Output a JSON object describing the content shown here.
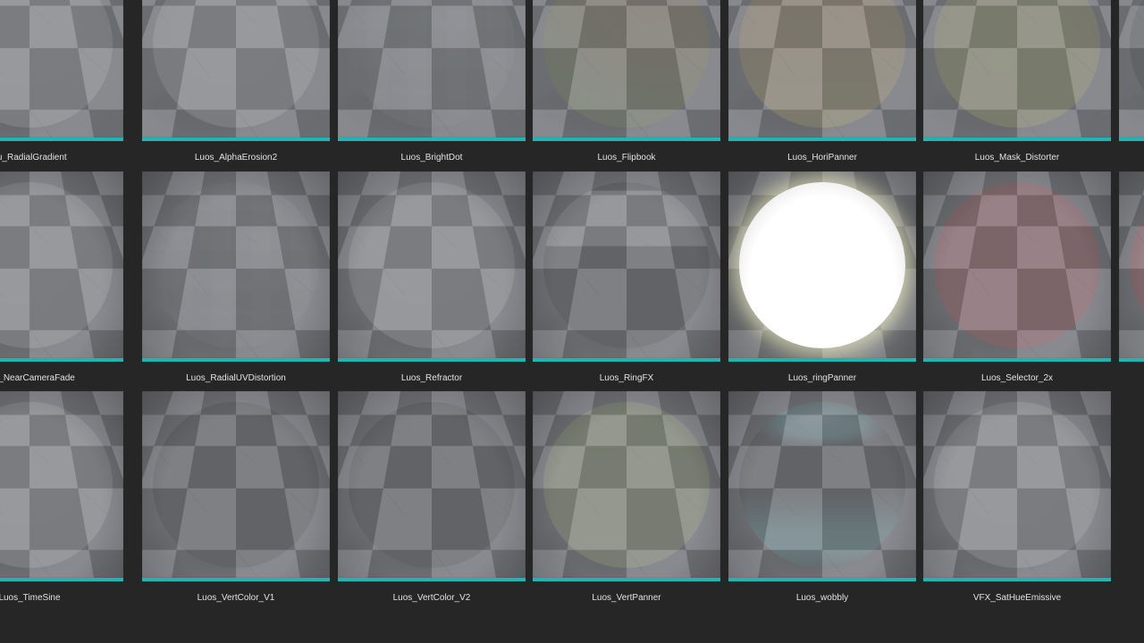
{
  "colors": {
    "background": "#262626",
    "accent_bar": "#1fb5b5",
    "label_text": "#e2e2e2"
  },
  "assets": [
    {
      "label": "Lu_RadialGradient",
      "material": "m-white"
    },
    {
      "label": "Luos_AlphaErosion2",
      "material": "m-white"
    },
    {
      "label": "Luos_BrightDot",
      "material": "m-grey"
    },
    {
      "label": "Luos_Flipbook",
      "material": "m-flip"
    },
    {
      "label": "Luos_HoriPanner",
      "material": "m-orange"
    },
    {
      "label": "Luos_Mask_Distorter",
      "material": "m-mask"
    },
    {
      "label": "",
      "material": "m-black"
    },
    {
      "label": "uos_NearCameraFade",
      "material": "m-white"
    },
    {
      "label": "Luos_RadialUVDistortion",
      "material": "m-grey"
    },
    {
      "label": "Luos_Refractor",
      "material": "m-white"
    },
    {
      "label": "Luos_RingFX",
      "material": "m-ring"
    },
    {
      "label": "Luos_ringPanner",
      "material": "m-glow"
    },
    {
      "label": "Luos_Selector_2x",
      "material": "m-red"
    },
    {
      "label": "",
      "material": "m-red"
    },
    {
      "label": "Luos_TimeSine",
      "material": "m-white"
    },
    {
      "label": "Luos_VertColor_V1",
      "material": "m-black"
    },
    {
      "label": "Luos_VertColor_V2",
      "material": "m-black"
    },
    {
      "label": "Luos_VertPanner",
      "material": "m-vpan"
    },
    {
      "label": "Luos_wobbly",
      "material": "m-wobbly"
    },
    {
      "label": "VFX_SatHueEmissive",
      "material": "m-white"
    }
  ]
}
